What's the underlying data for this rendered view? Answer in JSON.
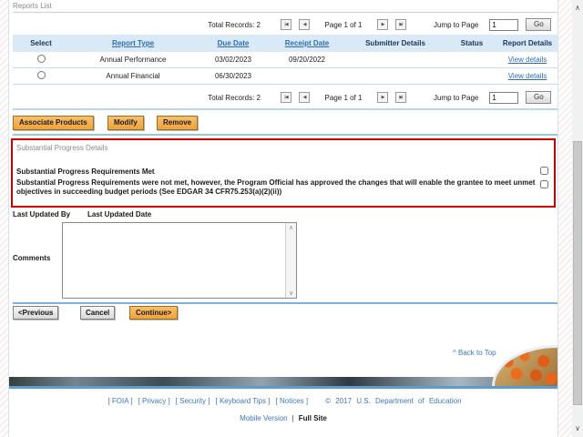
{
  "section": {
    "title": "Reports List"
  },
  "pagination": {
    "total_records": "Total Records: 2",
    "page_label": "Page 1 of 1",
    "jump_label": "Jump to Page",
    "jump_value": "1",
    "go": "Go",
    "icons": {
      "first": "|◀",
      "prev": "◀",
      "next": "▶",
      "last": "▶|"
    }
  },
  "table": {
    "headers": [
      "Select",
      "Report Type",
      "Due Date",
      "Receipt Date",
      "Submitter Details",
      "Status",
      "Report Details"
    ],
    "rows": [
      {
        "report_type": "Annual Performance",
        "due_date": "03/02/2023",
        "receipt_date": "09/20/2022",
        "submitter": "",
        "status": "",
        "details": "View details"
      },
      {
        "report_type": "Annual Financial",
        "due_date": "06/30/2023",
        "receipt_date": "",
        "submitter": "",
        "status": "",
        "details": "View details"
      }
    ]
  },
  "actions": {
    "associate": "Associate Products",
    "modify": "Modify",
    "remove": "Remove"
  },
  "progress": {
    "title": "Substantial Progress Details",
    "met_label": "Substantial Progress Requirements Met",
    "not_met_label": "Substantial Progress Requirements were not met, however, the Program Official has approved the changes that will enable the grantee to meet unmet objectives in succeeding budget periods (See EDGAR 34 CFR75.253(a)(2)(ii))"
  },
  "updated": {
    "by_label": "Last Updated By",
    "date_label": "Last Updated Date",
    "comments_label": "Comments"
  },
  "nav": {
    "previous": "<Previous",
    "cancel": "Cancel",
    "continue": "Continue>"
  },
  "back_to_top": "^ Back to Top",
  "footer": {
    "links": [
      "[ FOIA ]",
      "[ Privacy ]",
      "[ Security ]",
      "[ Keyboard Tips ]",
      "[ Notices ]"
    ],
    "copyright": "© 2017 U.S. Department of Education",
    "mobile": "Mobile Version",
    "separator": "|",
    "full_site": "Full Site"
  },
  "colors": {
    "accent_orange": "#efa33a",
    "header_blue_bg": "#d9e9f6",
    "link_blue": "#2d6cb4",
    "alert_red": "#cc0000",
    "footer_blue": "#3b78bc"
  }
}
